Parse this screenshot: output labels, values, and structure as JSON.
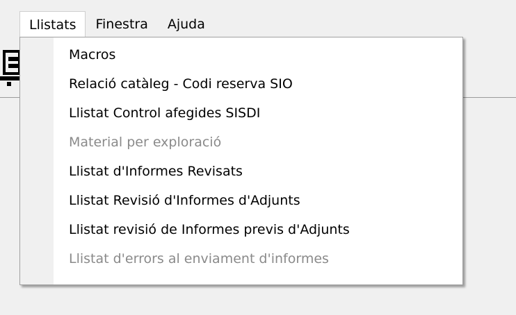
{
  "menubar": {
    "items": [
      {
        "label": "Llistats",
        "active": true
      },
      {
        "label": "Finestra",
        "active": false
      },
      {
        "label": "Ajuda",
        "active": false
      }
    ]
  },
  "toolbar": {
    "partial_icon": "printer-icon"
  },
  "dropdown": {
    "items": [
      {
        "label": "Macros",
        "enabled": true
      },
      {
        "label": "Relació catàleg - Codi reserva SIO",
        "enabled": true
      },
      {
        "label": "Llistat Control afegides SISDI",
        "enabled": true
      },
      {
        "label": "Material per exploració",
        "enabled": false
      },
      {
        "label": "Llistat d'Informes Revisats",
        "enabled": true
      },
      {
        "label": "Llistat Revisió d'Informes d'Adjunts",
        "enabled": true
      },
      {
        "label": "Llistat revisió de Informes previs d'Adjunts",
        "enabled": true
      },
      {
        "label": "Llistat d'errors al enviament d'informes",
        "enabled": false
      }
    ]
  },
  "colors": {
    "background": "#f0f0f0",
    "menu_background": "#ffffff",
    "disabled_text": "#8a8a8a"
  }
}
